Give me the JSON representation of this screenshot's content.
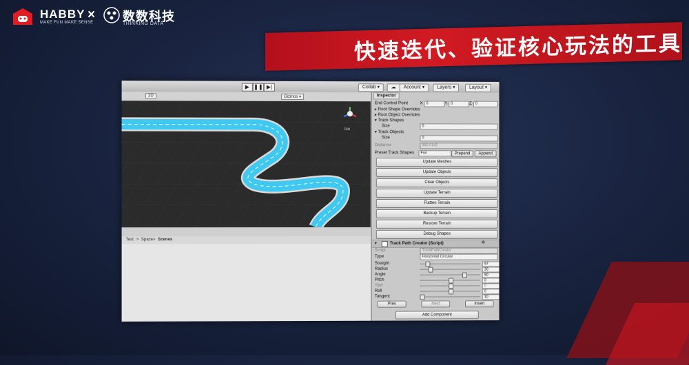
{
  "header": {
    "habby_name": "HABBY",
    "habby_tagline": "MAKE FUN MAKE SENSE",
    "separator": "×",
    "partner_name": "数数科技",
    "partner_tagline": "THINKING DATA",
    "slide_title": "快速迭代、验证核心玩法的工具"
  },
  "editor": {
    "toolbar": {
      "play_icon": "▶",
      "pause_icon": "❚❚",
      "step_icon": "▶|",
      "collab": "Collab ▾",
      "account": "Account ▾",
      "layers": "Layers ▾",
      "layout": "Layout ▾"
    },
    "scene": {
      "view_mode": "2D",
      "gizmos": "Gizmos ▾",
      "projection": "Iso"
    },
    "project": {
      "breadcrumb": [
        "Test",
        "Space",
        "Scenes"
      ],
      "breadcrumb_sep": ">"
    },
    "inspector": {
      "tab": "Inspector",
      "end_control_point_label": "End Control Point",
      "xyz": [
        "X",
        "Y",
        "Z"
      ],
      "end_control_point_values": [
        "0",
        "0",
        "0"
      ],
      "root_shape_overrides": "▸ Root Shape Overrides",
      "root_object_overrides": "▸ Root Object Overrides",
      "track_shapes": "▾ Track Shapes",
      "track_shapes_size_label": "Size",
      "track_shapes_size": "0",
      "track_objects": "▾ Track Objects",
      "track_objects_size_label": "Size",
      "track_objects_size": "0",
      "distance_label": "Distance",
      "distance_value": "965.0142",
      "preset_label": "Preset Track Shapes",
      "preset_value": "Fun",
      "prepend": "Prepend",
      "append": "Append",
      "buttons": [
        "Update Meshes",
        "Update Objects",
        "Clear Objects",
        "Update Terrain",
        "Flatten Terrain",
        "Backup Terrain",
        "Restore Terrain",
        "Debug Shapes"
      ],
      "component_title": "Track Path Creator (Script)",
      "script_label": "Script",
      "script_value": "TrackPathCreator",
      "type_label": "Type",
      "type_value": "Horizontal Circular",
      "params": [
        {
          "label": "Straight",
          "value": "97",
          "level": 0.1,
          "enabled": true
        },
        {
          "label": "Radius",
          "value": "30",
          "level": 0.15,
          "enabled": true
        },
        {
          "label": "Angle",
          "value": "90",
          "level": 0.75,
          "enabled": true
        },
        {
          "label": "Pitch",
          "value": "0",
          "level": 0.5,
          "enabled": true
        },
        {
          "label": "Yaw",
          "value": "0",
          "level": 0.5,
          "enabled": false
        },
        {
          "label": "Roll",
          "value": "0",
          "level": 0.5,
          "enabled": true
        },
        {
          "label": "Tangent",
          "value": "10",
          "level": 0.0,
          "enabled": true
        }
      ],
      "prev": "Prev",
      "next": "Next",
      "insert": "Insert",
      "add_component": "Add Component"
    }
  },
  "colors": {
    "banner_red": "#c8141e",
    "track_cyan": "#3fc8f0",
    "track_border": "#dcdcdc",
    "ground": "#2b2b2b"
  }
}
